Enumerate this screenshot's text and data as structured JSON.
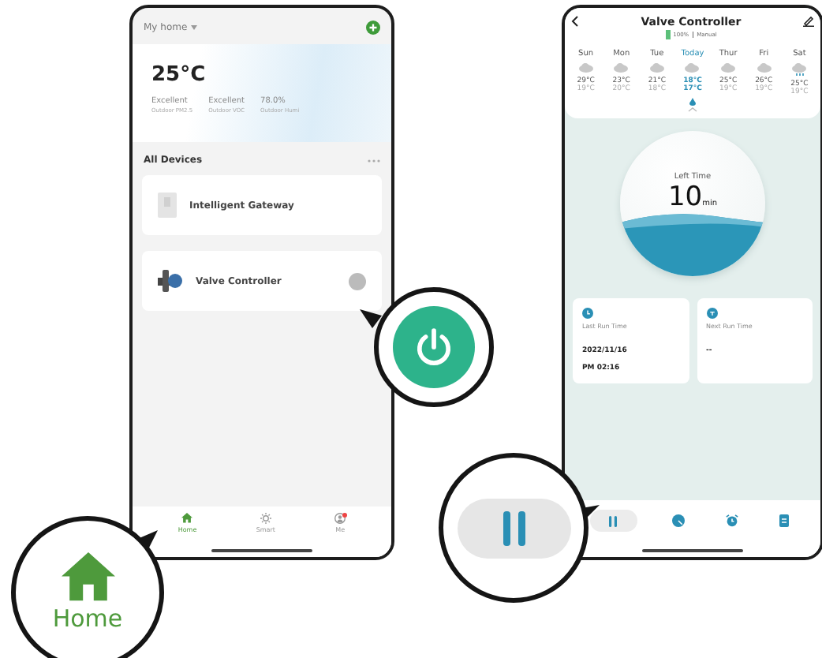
{
  "home_screen": {
    "header": {
      "title": "My home"
    },
    "weather": {
      "temperature": "25°C",
      "stats": [
        {
          "value": "Excellent",
          "label": "Outdoor PM2.5"
        },
        {
          "value": "Excellent",
          "label": "Outdoor VOC"
        },
        {
          "value": "78.0%",
          "label": "Outdoor Humi"
        }
      ]
    },
    "section_title": "All Devices",
    "devices": [
      {
        "kind": "gateway",
        "name": "Intelligent Gateway",
        "power_button": false
      },
      {
        "kind": "valve",
        "name": "Valve Controller",
        "power_button": true
      }
    ],
    "nav": [
      {
        "kind": "home",
        "label": "Home",
        "selected": true,
        "badge": false
      },
      {
        "kind": "smart",
        "label": "Smart",
        "selected": false,
        "badge": false
      },
      {
        "kind": "me",
        "label": "Me",
        "selected": false,
        "badge": true
      }
    ]
  },
  "controller_screen": {
    "title": "Valve Controller",
    "battery": "100%",
    "mode": "Manual",
    "forecast": [
      {
        "day": "Sun",
        "kind": "cloud",
        "high": "29°C",
        "low": "19°C",
        "selected": false
      },
      {
        "day": "Mon",
        "kind": "cloud",
        "high": "23°C",
        "low": "20°C",
        "selected": false
      },
      {
        "day": "Tue",
        "kind": "cloud",
        "high": "21°C",
        "low": "18°C",
        "selected": false
      },
      {
        "day": "Today",
        "kind": "cloud",
        "high": "18°C",
        "low": "17°C",
        "selected": true
      },
      {
        "day": "Thur",
        "kind": "cloud",
        "high": "25°C",
        "low": "19°C",
        "selected": false
      },
      {
        "day": "Fri",
        "kind": "cloud",
        "high": "26°C",
        "low": "19°C",
        "selected": false
      },
      {
        "day": "Sat",
        "kind": "rain",
        "high": "25°C",
        "low": "19°C",
        "selected": false
      }
    ],
    "timer": {
      "label": "Left Time",
      "value": "10",
      "unit": "min"
    },
    "runs": [
      {
        "kind": "last",
        "label": "Last Run Time",
        "lines": [
          "2022/11/16",
          "PM 02:16"
        ]
      },
      {
        "kind": "next",
        "label": "Next Run Time",
        "lines": [
          "--"
        ]
      }
    ],
    "nav": [
      {
        "kind": "pause",
        "selected": true
      },
      {
        "kind": "timer",
        "selected": false
      },
      {
        "kind": "alarm",
        "selected": false
      },
      {
        "kind": "log",
        "selected": false
      }
    ]
  },
  "callouts": [
    {
      "kind": "power"
    },
    {
      "kind": "home",
      "label": "Home"
    },
    {
      "kind": "pause"
    }
  ]
}
